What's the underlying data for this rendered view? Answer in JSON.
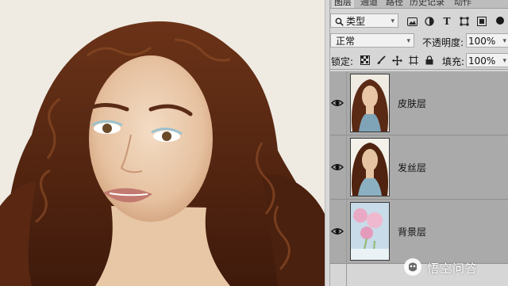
{
  "tabs": [
    {
      "label": "图层",
      "active": true
    },
    {
      "label": "通道",
      "active": false
    },
    {
      "label": "路径",
      "active": false
    },
    {
      "label": "历史记录",
      "active": false
    },
    {
      "label": "动作",
      "active": false
    }
  ],
  "filter": {
    "kind_label": "类型",
    "icons": [
      "image-filter-icon",
      "adjustment-filter-icon",
      "type-filter-icon",
      "shape-filter-icon",
      "smart-object-filter-icon"
    ]
  },
  "blend": {
    "mode": "正常",
    "opacity_label": "不透明度:",
    "opacity_value": "100%"
  },
  "lock": {
    "label": "锁定:",
    "fill_label": "填充:",
    "fill_value": "100%"
  },
  "layers": [
    {
      "name": "皮肤层",
      "visible": true
    },
    {
      "name": "发丝层",
      "visible": true
    },
    {
      "name": "背景层",
      "visible": true
    }
  ],
  "watermark": {
    "text": "悟空问答"
  },
  "colors": {
    "panel_bg": "#d6d6d6",
    "layer_bg": "#aaaaaa",
    "canvas_bg": "#efebe3",
    "hair": "#5b2a14"
  }
}
